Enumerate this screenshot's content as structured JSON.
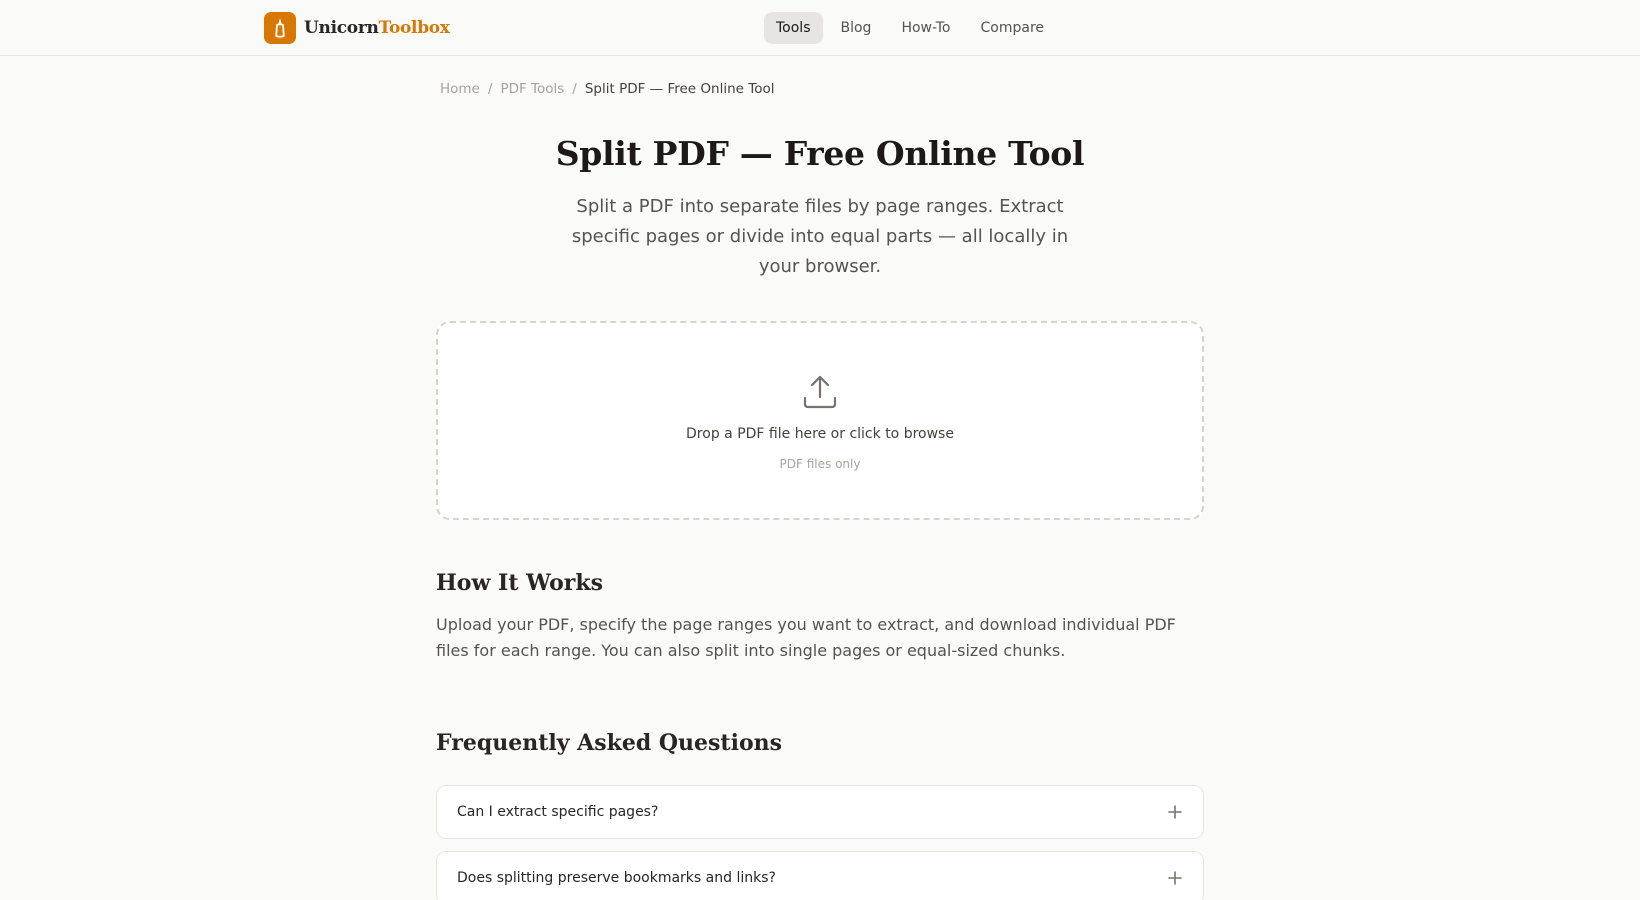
{
  "header": {
    "logo_name": "Unicorn",
    "logo_accent": "Toolbox",
    "brand_color": "#d97706",
    "nav": [
      {
        "label": "Tools",
        "active": true
      },
      {
        "label": "Blog",
        "active": false
      },
      {
        "label": "How-To",
        "active": false
      },
      {
        "label": "Compare",
        "active": false
      }
    ]
  },
  "breadcrumb": {
    "items": [
      "Home",
      "PDF Tools",
      "Split PDF — Free Online Tool"
    ],
    "separator": "/"
  },
  "main": {
    "title": "Split PDF — Free Online Tool",
    "subtitle": "Split a PDF into separate files by page ranges. Extract specific pages or divide into equal parts — all locally in your browser.",
    "dropzone": {
      "icon": "upload-icon",
      "label": "Drop a PDF file here or click to browse",
      "hint": "PDF files only"
    }
  },
  "how_it_works": {
    "heading": "How It Works",
    "body": "Upload your PDF, specify the page ranges you want to extract, and download individual PDF files for each range. You can also split into single pages or equal-sized chunks."
  },
  "faq": {
    "heading": "Frequently Asked Questions",
    "items": [
      {
        "question": "Can I extract specific pages?",
        "icon": "plus-icon"
      },
      {
        "question": "Does splitting preserve bookmarks and links?",
        "icon": "plus-icon"
      }
    ]
  }
}
